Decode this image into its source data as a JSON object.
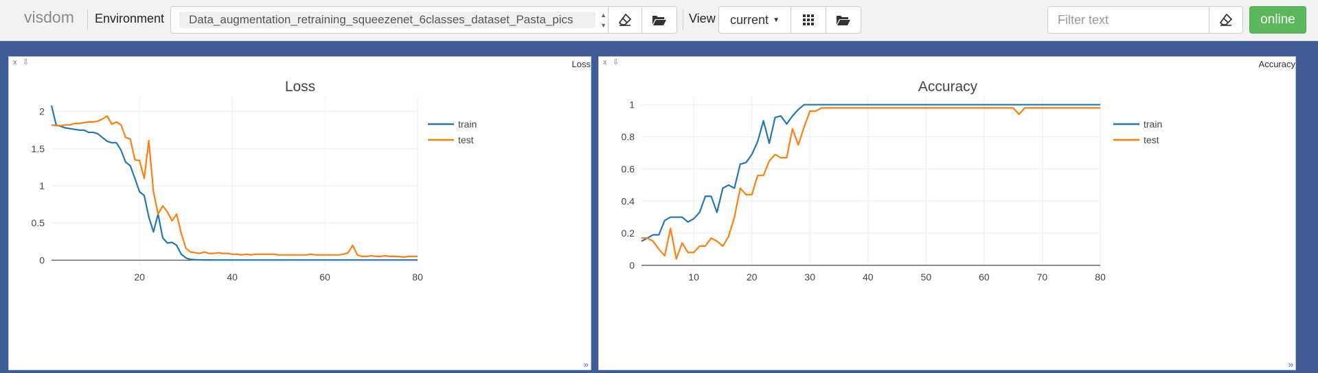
{
  "navbar": {
    "brand": "visdom",
    "environment_label": "Environment",
    "environment_value": "Data_augmentation_retraining_squeezenet_6classes_dataset_Pasta_pics",
    "view_label": "View",
    "view_value": "current",
    "filter_placeholder": "Filter text",
    "online_label": "online"
  },
  "panes": [
    {
      "name": "Loss"
    },
    {
      "name": "Accuracy"
    }
  ],
  "colors": {
    "train": "#1f77b4",
    "test": "#ff7f0e",
    "background": "#3d5c98",
    "online": "#5cb85c"
  },
  "icons": [
    "eraser-icon",
    "folder-open-icon",
    "grid-icon",
    "folder-open-icon",
    "eraser-icon",
    "close-icon",
    "download-icon",
    "resize-icon"
  ],
  "chart_data": [
    {
      "type": "line",
      "title": "Loss",
      "xlim": [
        1,
        80
      ],
      "ylim": [
        -0.07,
        2.2
      ],
      "xticks": [
        20,
        40,
        60,
        80
      ],
      "yticks": [
        0,
        0.5,
        1,
        1.5,
        2
      ],
      "ytick_labels": [
        "0",
        "0.5",
        "1",
        "1.5",
        "2"
      ],
      "grid": true,
      "legend": "top-right",
      "series": [
        {
          "name": "train",
          "color": "#1f77b4",
          "values": [
            2.08,
            1.82,
            1.8,
            1.78,
            1.77,
            1.76,
            1.75,
            1.75,
            1.72,
            1.72,
            1.7,
            1.65,
            1.6,
            1.58,
            1.58,
            1.48,
            1.32,
            1.27,
            1.1,
            0.92,
            0.87,
            0.58,
            0.38,
            0.62,
            0.3,
            0.23,
            0.24,
            0.2,
            0.08,
            0.03,
            0.01,
            0.005,
            0.004,
            0.003,
            0.003,
            0.002,
            0.002,
            0.002,
            0.002,
            0.002,
            0.002,
            0.002,
            0.002,
            0.002,
            0.002,
            0.002,
            0.002,
            0.002,
            0.002,
            0.002,
            0.002,
            0.002,
            0.002,
            0.002,
            0.002,
            0.002,
            0.002,
            0.002,
            0.002,
            0.002,
            0.002,
            0.002,
            0.002,
            0.002,
            0.002,
            0.002,
            0.002,
            0.002,
            0.002,
            0.002,
            0.002,
            0.002,
            0.002,
            0.002,
            0.002,
            0.002,
            0.002,
            0.002,
            0.002,
            0.002
          ]
        },
        {
          "name": "test",
          "color": "#ff7f0e",
          "values": [
            1.82,
            1.81,
            1.81,
            1.82,
            1.82,
            1.84,
            1.84,
            1.85,
            1.86,
            1.86,
            1.87,
            1.9,
            1.94,
            1.83,
            1.86,
            1.82,
            1.65,
            1.63,
            1.35,
            1.34,
            1.1,
            1.61,
            0.92,
            0.62,
            0.73,
            0.65,
            0.53,
            0.62,
            0.36,
            0.16,
            0.11,
            0.1,
            0.09,
            0.11,
            0.09,
            0.09,
            0.1,
            0.09,
            0.09,
            0.08,
            0.08,
            0.07,
            0.08,
            0.07,
            0.08,
            0.08,
            0.08,
            0.08,
            0.08,
            0.07,
            0.07,
            0.07,
            0.07,
            0.07,
            0.07,
            0.07,
            0.08,
            0.07,
            0.07,
            0.07,
            0.07,
            0.07,
            0.07,
            0.08,
            0.1,
            0.2,
            0.07,
            0.05,
            0.05,
            0.06,
            0.05,
            0.05,
            0.06,
            0.05,
            0.05,
            0.05,
            0.04,
            0.05,
            0.05,
            0.05
          ]
        }
      ]
    },
    {
      "type": "line",
      "title": "Accuracy",
      "xlim": [
        1,
        80
      ],
      "ylim": [
        0,
        1.05
      ],
      "xticks": [
        10,
        20,
        30,
        40,
        50,
        60,
        70,
        80
      ],
      "yticks": [
        0,
        0.2,
        0.4,
        0.6,
        0.8,
        1
      ],
      "ytick_labels": [
        "0",
        "0.2",
        "0.4",
        "0.6",
        "0.8",
        "1"
      ],
      "grid": true,
      "legend": "top-right",
      "series": [
        {
          "name": "train",
          "color": "#1f77b4",
          "values": [
            0.15,
            0.17,
            0.19,
            0.19,
            0.28,
            0.3,
            0.3,
            0.3,
            0.27,
            0.29,
            0.33,
            0.43,
            0.43,
            0.33,
            0.48,
            0.5,
            0.48,
            0.63,
            0.64,
            0.69,
            0.77,
            0.9,
            0.76,
            0.92,
            0.93,
            0.88,
            0.93,
            0.97,
            1,
            1,
            1,
            1,
            1,
            1,
            1,
            1,
            1,
            1,
            1,
            1,
            1,
            1,
            1,
            1,
            1,
            1,
            1,
            1,
            1,
            1,
            1,
            1,
            1,
            1,
            1,
            1,
            1,
            1,
            1,
            1,
            1,
            1,
            1,
            1,
            1,
            1,
            1,
            1,
            1,
            1,
            1,
            1,
            1,
            1,
            1,
            1,
            1,
            1,
            1,
            1
          ]
        },
        {
          "name": "test",
          "color": "#ff7f0e",
          "values": [
            0.17,
            0.17,
            0.15,
            0.1,
            0.06,
            0.23,
            0.04,
            0.14,
            0.08,
            0.08,
            0.12,
            0.12,
            0.17,
            0.15,
            0.12,
            0.18,
            0.3,
            0.48,
            0.44,
            0.44,
            0.56,
            0.56,
            0.65,
            0.69,
            0.67,
            0.67,
            0.85,
            0.75,
            0.86,
            0.96,
            0.96,
            0.98,
            0.98,
            0.98,
            0.98,
            0.98,
            0.98,
            0.98,
            0.98,
            0.98,
            0.98,
            0.98,
            0.98,
            0.98,
            0.98,
            0.98,
            0.98,
            0.98,
            0.98,
            0.98,
            0.98,
            0.98,
            0.98,
            0.98,
            0.98,
            0.98,
            0.98,
            0.98,
            0.98,
            0.98,
            0.98,
            0.98,
            0.98,
            0.98,
            0.98,
            0.94,
            0.98,
            0.98,
            0.98,
            0.98,
            0.98,
            0.98,
            0.98,
            0.98,
            0.98,
            0.98,
            0.98,
            0.98,
            0.98,
            0.98
          ]
        }
      ]
    }
  ]
}
